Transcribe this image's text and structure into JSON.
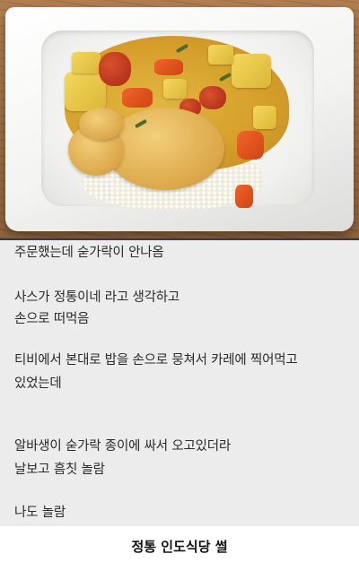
{
  "post": {
    "lines": [
      "주문했는데 숟가락이 안나옴",
      "사스가 정통이네 라고 생각하고",
      "손으로 떠먹음",
      "티비에서 본대로 밥을 손으로 뭉쳐서 카레에 찍어먹고",
      "있었는데",
      "알바생이 숟가락 종이에 싸서 오고있더라",
      "날보고 흠칫 놀람",
      "나도 놀람"
    ]
  },
  "caption": "정통 인도식당 썰"
}
